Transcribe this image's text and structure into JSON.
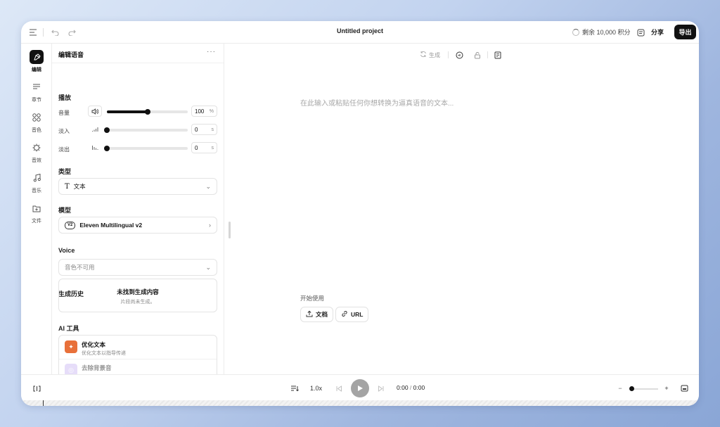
{
  "window": {
    "title": "Untitled project",
    "credits": "剩余 10,000 积分",
    "share_label": "分享",
    "export_label": "导出"
  },
  "rail": {
    "items": [
      {
        "label": "编辑",
        "icon": "pen-nib-icon",
        "active": true
      },
      {
        "label": "章节",
        "icon": "lines-icon"
      },
      {
        "label": "音色",
        "icon": "grid-circles-icon"
      },
      {
        "label": "音效",
        "icon": "sparkle-icon"
      },
      {
        "label": "音乐",
        "icon": "music-note-icon"
      },
      {
        "label": "文件",
        "icon": "folder-plus-icon"
      }
    ]
  },
  "panel": {
    "title": "编辑语音",
    "playback": {
      "heading": "播放",
      "volume": {
        "label": "音量",
        "value": "100",
        "unit": "%",
        "fraction": 0.5
      },
      "fade_in": {
        "label": "淡入",
        "value": "0",
        "unit": "s",
        "fraction": 0
      },
      "fade_out": {
        "label": "淡出",
        "value": "0",
        "unit": "s",
        "fraction": 0
      }
    },
    "type": {
      "heading": "类型",
      "value": "文本"
    },
    "model": {
      "heading": "模型",
      "badge": "V2",
      "value": "Eleven Multilingual v2"
    },
    "voice": {
      "heading": "Voice",
      "value": "音色不可用"
    },
    "history": {
      "heading": "生成历史",
      "empty_title": "未找到生成内容",
      "empty_sub": "片段尚未生成。"
    },
    "ai_tools": {
      "heading": "AI 工具",
      "items": [
        {
          "title": "优化文本",
          "subtitle": "优化文本以指导传递",
          "color": "#e8703a"
        },
        {
          "title": "去除背景音",
          "subtitle": "",
          "color": "#c9b6f2"
        }
      ]
    }
  },
  "editor": {
    "generate_label": "生成",
    "placeholder": "在此输入或粘贴任何你想转换为逼真语音的文本...",
    "getting_started": "开始使用",
    "doc_label": "文档",
    "url_label": "URL"
  },
  "player": {
    "speed": "1.0x",
    "current_time": "0:00",
    "separator": "/",
    "total_time": "0:00"
  }
}
